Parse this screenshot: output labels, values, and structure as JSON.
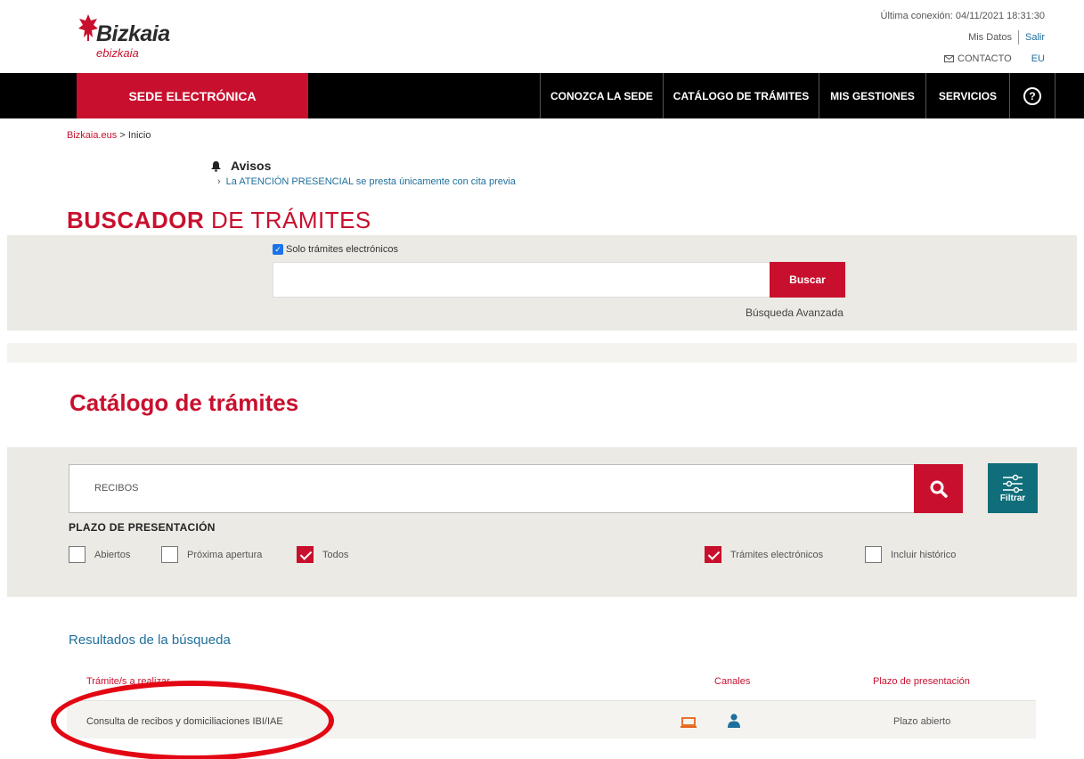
{
  "header": {
    "logo_text": "Bizkaia",
    "logo_sub": "ebizkaia",
    "last_connection": "Última conexión: 04/11/2021 18:31:30",
    "mis_datos": "Mis Datos",
    "salir": "Salir",
    "contacto": "CONTACTO",
    "lang": "EU"
  },
  "nav": {
    "sede": "SEDE ELECTRÓNICA",
    "items": [
      "CONOZCA LA SEDE",
      "CATÁLOGO DE TRÁMITES",
      "MIS GESTIONES",
      "SERVICIOS"
    ],
    "help": "?"
  },
  "breadcrumb": {
    "home": "Bizkaia.eus",
    "sep": " > ",
    "current": "Inicio"
  },
  "avisos": {
    "title": "Avisos",
    "items": [
      "La ATENCIÓN PRESENCIAL se presta únicamente con cita previa"
    ]
  },
  "buscador": {
    "title_bold": "BUSCADOR",
    "title_rest": " DE TRÁMITES",
    "checkbox_label": "Solo trámites electrónicos",
    "search_value": "",
    "button": "Buscar",
    "advanced": "Búsqueda Avanzada"
  },
  "catalogo": {
    "title": "Catálogo de trámites",
    "search_value": "RECIBOS",
    "filter_button": "Filtrar",
    "plazo_title": "PLAZO DE PRESENTACIÓN",
    "filters": [
      {
        "label": "Abiertos",
        "checked": false
      },
      {
        "label": "Próxima apertura",
        "checked": false
      },
      {
        "label": "Todos",
        "checked": true
      },
      {
        "label": "Trámites electrónicos",
        "checked": true
      },
      {
        "label": "Incluir histórico",
        "checked": false
      }
    ]
  },
  "results": {
    "title": "Resultados de la búsqueda",
    "columns": [
      "Trámite/s a realizar",
      "Canales",
      "Plazo de presentación"
    ],
    "rows": [
      {
        "name": "Consulta de recibos y domiciliaciones IBI/IAE",
        "channels": [
          "laptop-icon",
          "person-icon"
        ],
        "plazo": "Plazo abierto"
      }
    ]
  },
  "colors": {
    "brand_red": "#c8102e",
    "teal": "#0f6e7a",
    "link_blue": "#1f6f9c",
    "annotation_red": "#e30613"
  }
}
